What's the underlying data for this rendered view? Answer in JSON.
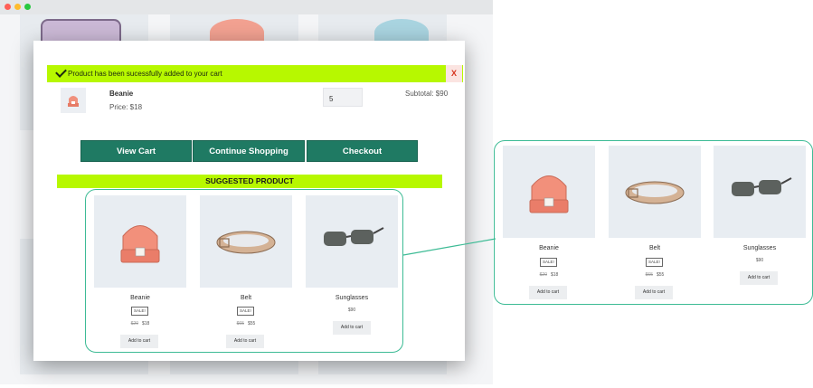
{
  "notice": {
    "text": "Product has been sucessfully added to your cart",
    "close": "X"
  },
  "cart_item": {
    "name": "Beanie",
    "price": "Price: $18",
    "quantity": "5",
    "subtotal": "Subtotal: $90"
  },
  "actions": {
    "view_cart": "View Cart",
    "continue_shopping": "Continue Shopping",
    "checkout": "Checkout"
  },
  "suggested": {
    "heading": "SUGGESTED PRODUCT",
    "products": [
      {
        "name": "Beanie",
        "badge": "SALE!",
        "old_price": "$20",
        "price": "$18",
        "button": "Add to cart"
      },
      {
        "name": "Belt",
        "badge": "SALE!",
        "old_price": "$65",
        "price": "$55",
        "button": "Add to cart"
      },
      {
        "name": "Sunglasses",
        "badge": "",
        "old_price": "",
        "price": "$90",
        "button": "Add to cart"
      }
    ]
  },
  "colors": {
    "accent_green": "#b7f800",
    "button_teal": "#1f7a63",
    "frame": "#3dbb95"
  },
  "icons": [
    "check-icon",
    "close-icon",
    "beanie-image",
    "belt-image",
    "sunglasses-image"
  ]
}
